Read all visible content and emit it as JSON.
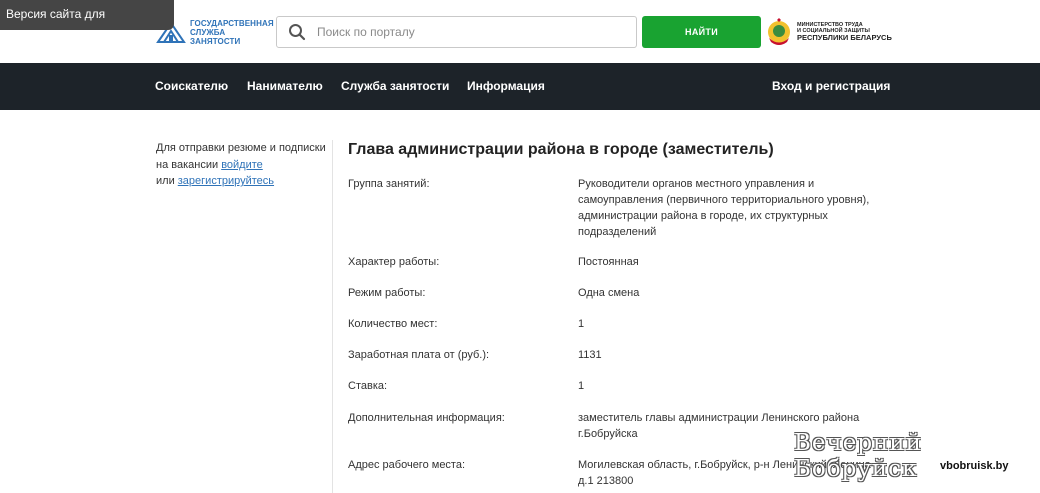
{
  "accessibility": {
    "label": "Версия сайта для слабовидящих"
  },
  "header": {
    "logo_text_line1": "ГОСУДАРСТВЕННАЯ",
    "logo_text_line2": "СЛУЖБА ЗАНЯТОСТИ",
    "search_placeholder": "Поиск по порталу",
    "search_button": "НАЙТИ",
    "ministry_line1": "МИНИСТЕРСТВО ТРУДА",
    "ministry_line2": "И СОЦИАЛЬНОЙ ЗАЩИТЫ",
    "ministry_line3": "РЕСПУБЛИКИ БЕЛАРУСЬ"
  },
  "nav": {
    "items": [
      "Соискателю",
      "Нанимателю",
      "Служба занятости",
      "Информация"
    ],
    "login": "Вход и регистрация"
  },
  "sidebar": {
    "text1": "Для отправки резюме и подписки на вакансии ",
    "link_login": "войдите",
    "text2": "или ",
    "link_register": "зарегистрируйтесь"
  },
  "vacancy": {
    "title": "Глава администрации района в городе (заместитель)",
    "rows": [
      {
        "label": "Группа занятий:",
        "value": "Руководители органов местного управления и самоуправления (первичного территориального уровня), администрации района в городе, их структурных подразделений"
      },
      {
        "label": "Характер работы:",
        "value": "Постоянная"
      },
      {
        "label": "Режим работы:",
        "value": "Одна смена"
      },
      {
        "label": "Количество мест:",
        "value": "1"
      },
      {
        "label": "Заработная плата от (руб.):",
        "value": "1131"
      },
      {
        "label": "Ставка:",
        "value": "1"
      },
      {
        "label": "Дополнительная информация:",
        "value": "заместитель главы администрации Ленинского района г.Бобруйска"
      },
      {
        "label": "Адрес рабочего места:",
        "value": "Могилевская область, г.Бобруйск, р-н Ленинский, Ленина д.1 213800"
      }
    ]
  },
  "watermark": {
    "title": "Вечерний Бобруйск",
    "url": "vbobruisk.by"
  },
  "colors": {
    "nav_bg": "#1d2329",
    "button_green": "#19a331",
    "link_blue": "#2f73b8"
  }
}
